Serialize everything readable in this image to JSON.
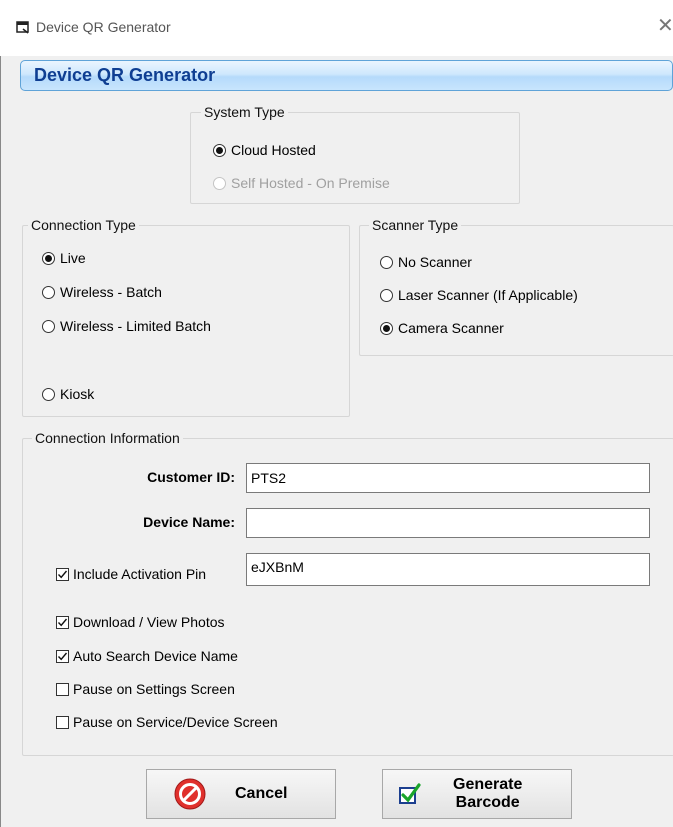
{
  "window": {
    "title": "Device QR Generator",
    "close_glyph": "✕"
  },
  "header": {
    "title": "Device QR Generator"
  },
  "system_type": {
    "legend": "System Type",
    "options": [
      {
        "label": "Cloud Hosted",
        "checked": true,
        "enabled": true
      },
      {
        "label": "Self Hosted - On Premise",
        "checked": false,
        "enabled": false
      }
    ]
  },
  "connection_type": {
    "legend": "Connection Type",
    "options": [
      {
        "label": "Live",
        "checked": true
      },
      {
        "label": "Wireless - Batch",
        "checked": false
      },
      {
        "label": "Wireless - Limited Batch",
        "checked": false
      },
      {
        "label": "Kiosk",
        "checked": false
      }
    ]
  },
  "scanner_type": {
    "legend": "Scanner Type",
    "options": [
      {
        "label": "No Scanner",
        "checked": false
      },
      {
        "label": "Laser Scanner (If Applicable)",
        "checked": false
      },
      {
        "label": "Camera Scanner",
        "checked": true
      }
    ]
  },
  "connection_info": {
    "legend": "Connection Information",
    "customer_id_label": "Customer ID:",
    "customer_id_value": "PTS2",
    "device_name_label": "Device Name:",
    "device_name_value": "",
    "include_pin_label": "Include Activation Pin",
    "include_pin_checked": true,
    "pin_value": "eJXBnM",
    "options": [
      {
        "label": "Download / View Photos",
        "checked": true
      },
      {
        "label": "Auto Search Device Name",
        "checked": true
      },
      {
        "label": "Pause on Settings Screen",
        "checked": false
      },
      {
        "label": "Pause on Service/Device Screen",
        "checked": false
      }
    ]
  },
  "buttons": {
    "cancel": "Cancel",
    "generate_line1": "Generate",
    "generate_line2": "Barcode"
  },
  "icons": {
    "app": "window-icon",
    "cancel": "no-entry-icon",
    "generate": "checkmark-box-icon"
  },
  "colors": {
    "header_text": "#0f3e92",
    "header_border": "#5fa3d8",
    "cancel_icon": "#e0302c",
    "check_green": "#1aa52a"
  }
}
